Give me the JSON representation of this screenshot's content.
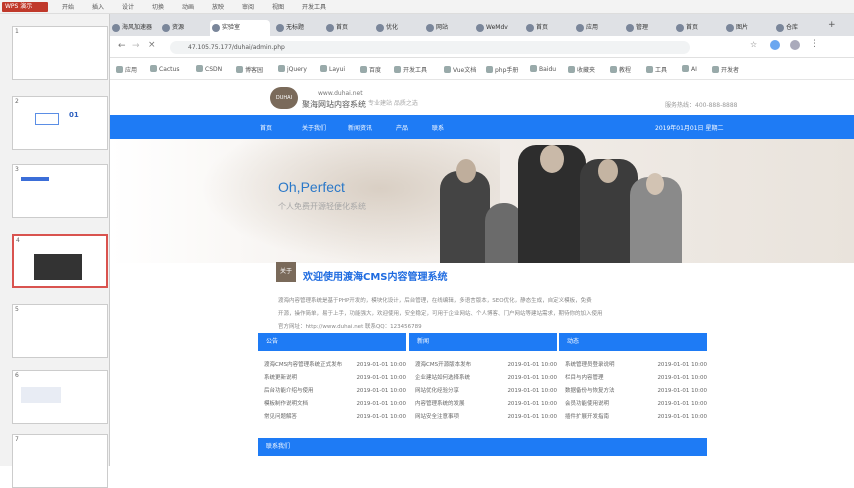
{
  "wps": {
    "app_label": "WPS 演示",
    "menus": [
      "开始",
      "插入",
      "设计",
      "切换",
      "动画",
      "放映",
      "审阅",
      "视图",
      "开发工具"
    ]
  },
  "slides": [
    {
      "num": "1"
    },
    {
      "num": "2",
      "label": "01"
    },
    {
      "num": "3"
    },
    {
      "num": "4"
    },
    {
      "num": "5"
    },
    {
      "num": "6"
    },
    {
      "num": "7"
    }
  ],
  "browser": {
    "tabs": [
      "海风加速器",
      "资源",
      "实验室",
      "无标题",
      "首页",
      "优化",
      "网站",
      "WeMdv",
      "首页",
      "应用",
      "管理",
      "首页",
      "图片",
      "仓库"
    ],
    "url": "47.105.75.177/duhai/admin.php",
    "bookmarks": [
      "应用",
      "Cactus",
      "CSDN",
      "博客园",
      "jQuery",
      "Layui",
      "百度",
      "开发工具",
      "Vue文档",
      "php手册",
      "Baidu",
      "收藏夹",
      "教程",
      "工具",
      "AI",
      "开发者"
    ]
  },
  "site": {
    "logo_text": "DUHAI CMS",
    "name": "聚海网站内容系统",
    "url_text": "www.duhai.net",
    "slogan": "专业建站 品质之选",
    "hotline": "服务热线：400-888-8888",
    "nav": [
      "首页",
      "关于我们",
      "新闻资讯",
      "产品",
      "联系"
    ],
    "nav_right": "2019年01月01日 星期二",
    "banner_title": "Oh,Perfect",
    "banner_sub": "个人免费开源轻便化系统",
    "welcome_badge": "关于",
    "welcome_title": "欢迎使用渡海CMS内容管理系统",
    "intro": [
      "渡海内容管理系统是基于PHP开发的，模块化设计，后台管理，在线编辑，多语言版本，SEO优化，静态生成，自定义模板，免费",
      "开源，操作简单，易于上手，功能强大，欢迎使用，安全稳定，可用于企业网站、个人博客、门户网站等建站需求，期待你的加入使用",
      "官方网址：http://www.duhai.net 联系QQ：123456789"
    ],
    "columns": [
      {
        "title": "公告",
        "rows": [
          {
            "t": "渡海CMS内容管理系统正式发布",
            "d": "2019-01-01 10:00"
          },
          {
            "t": "系统更新说明",
            "d": "2019-01-01 10:00"
          },
          {
            "t": "后台功能介绍与使用",
            "d": "2019-01-01 10:00"
          },
          {
            "t": "模板制作说明文档",
            "d": "2019-01-01 10:00"
          },
          {
            "t": "常见问题解答",
            "d": "2019-01-01 10:00"
          }
        ]
      },
      {
        "title": "新闻",
        "rows": [
          {
            "t": "渡海CMS开源版本发布",
            "d": "2019-01-01 10:00"
          },
          {
            "t": "企业建站如何选择系统",
            "d": "2019-01-01 10:00"
          },
          {
            "t": "网站优化经验分享",
            "d": "2019-01-01 10:00"
          },
          {
            "t": "内容管理系统的发展",
            "d": "2019-01-01 10:00"
          },
          {
            "t": "网站安全注意事项",
            "d": "2019-01-01 10:00"
          }
        ]
      },
      {
        "title": "动态",
        "rows": [
          {
            "t": "系统管理员登录说明",
            "d": "2019-01-01 10:00"
          },
          {
            "t": "栏目与内容管理",
            "d": "2019-01-01 10:00"
          },
          {
            "t": "数据备份与恢复方法",
            "d": "2019-01-01 10:00"
          },
          {
            "t": "会员功能使用说明",
            "d": "2019-01-01 10:00"
          },
          {
            "t": "插件扩展开发指南",
            "d": "2019-01-01 10:00"
          }
        ]
      }
    ],
    "bottom_bar": "联系我们"
  },
  "colors": {
    "primary": "#1e7bf5",
    "accent": "#1e6be0",
    "wps_red": "#c0392b"
  }
}
